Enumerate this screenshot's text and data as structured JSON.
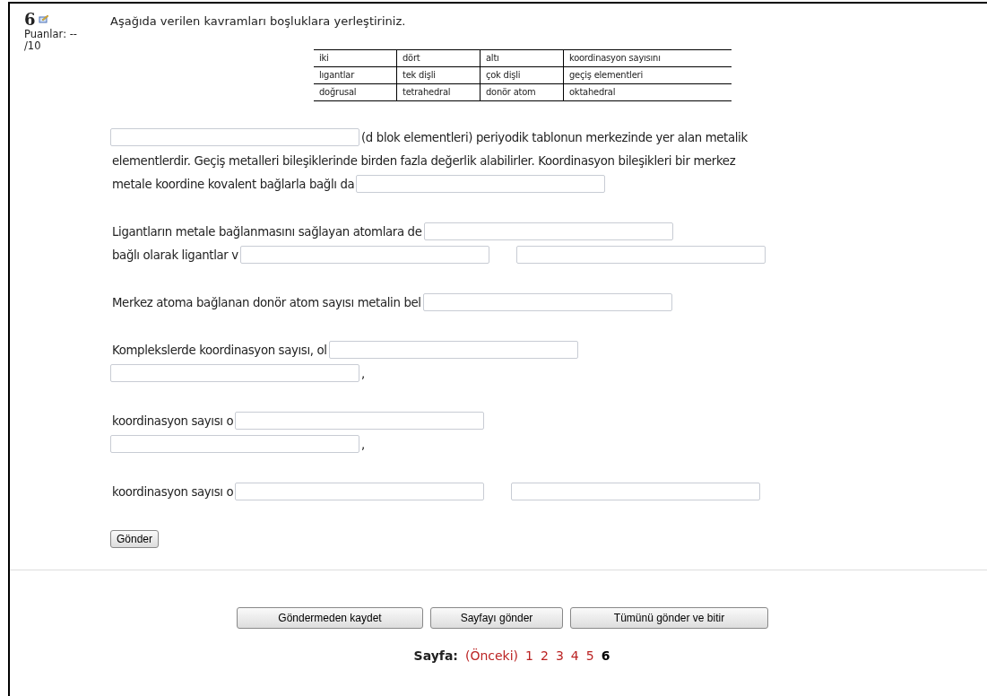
{
  "question": {
    "number": "6",
    "points_label": "Puanlar: --",
    "points_total": "/10",
    "instruction": "Aşağıda verilen kavramları boşluklara yerleştiriniz.",
    "terms": [
      [
        "iki",
        "dört",
        "altı",
        "koordinasyon sayısını"
      ],
      [
        "lıgantlar",
        "tek dişli",
        "çok dişli",
        "geçiş elementleri"
      ],
      [
        "doğrusal",
        "tetrahedral",
        "donör atom",
        "oktahedral"
      ]
    ],
    "blocks": [
      [
        [
          {
            "kind": "field"
          },
          {
            "kind": "text",
            "text": "(d blok elementleri) periyodik tablonun merkezinde yer alan metalik"
          }
        ],
        [
          {
            "kind": "text",
            "text": "elementlerdir. Geçiş metalleri bileşiklerinde birden fazla değerlik alabilirler. Koordinasyon bileşikleri bir merkez"
          }
        ],
        [
          {
            "kind": "text",
            "text": "metale koordine kovalent bağlarla bağlı  da"
          },
          {
            "kind": "field"
          }
        ]
      ],
      [
        [
          {
            "kind": "text",
            "text": "Ligantların metale bağlanmasını sağlayan atomlara  de"
          },
          {
            "kind": "field"
          }
        ],
        [
          {
            "kind": "text",
            "text": "bağlı olarak ligantlar v"
          },
          {
            "kind": "field"
          },
          {
            "kind": "gap"
          },
          {
            "kind": "field"
          }
        ]
      ],
      [
        [
          {
            "kind": "text",
            "text": "Merkez atoma bağlanan donör atom sayısı metalin  bel"
          },
          {
            "kind": "field"
          }
        ]
      ],
      [
        [
          {
            "kind": "text",
            "text": "Komplekslerde koordinasyon sayısı,  ol"
          },
          {
            "kind": "field"
          }
        ],
        [
          {
            "kind": "field"
          },
          {
            "kind": "text",
            "text": ","
          }
        ]
      ],
      [
        [
          {
            "kind": "text",
            "text": "koordinasyon sayısı  o"
          },
          {
            "kind": "field"
          }
        ],
        [
          {
            "kind": "field"
          },
          {
            "kind": "text",
            "text": ","
          }
        ]
      ],
      [
        [
          {
            "kind": "text",
            "text": "koordinasyon sayısı  o"
          },
          {
            "kind": "field"
          },
          {
            "kind": "gap"
          },
          {
            "kind": "field"
          }
        ]
      ]
    ],
    "submit": "Gönder"
  },
  "actions": [
    "Göndermeden kaydet",
    "Sayfayı gönder",
    "Tümünü gönder ve bitir"
  ],
  "pager": {
    "label": "Sayfa:",
    "previous": "(Önceki)",
    "pages": [
      {
        "label": "1",
        "selected": false
      },
      {
        "label": "2",
        "selected": false
      },
      {
        "label": "3",
        "selected": false
      },
      {
        "label": "4",
        "selected": false
      },
      {
        "label": "5",
        "selected": false
      },
      {
        "label": "6",
        "selected": true
      }
    ]
  }
}
